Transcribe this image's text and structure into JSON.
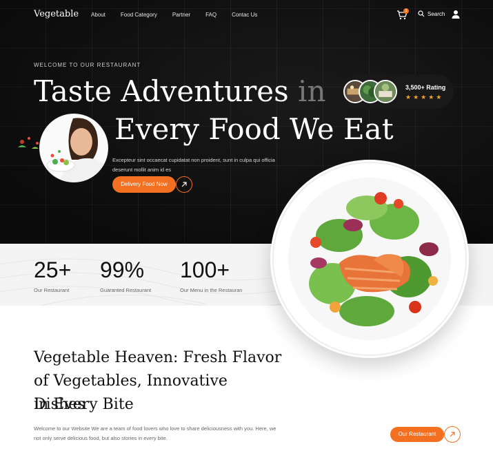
{
  "nav": {
    "logo": "Vegetable",
    "items": [
      "About",
      "Food Category",
      "Partner",
      "FAQ",
      "Contac Us"
    ],
    "cart_count": "3",
    "search_label": "Search"
  },
  "hero": {
    "eyebrow": "WELCOME TO OUR RESTAURANT",
    "title_line1_main": "Taste Adventures ",
    "title_line1_fade": "in",
    "title_line2": "Every Food We Eat",
    "subtitle": "Excepteur sint occaecat cupidatat non proident, sunt in culpa qui officia deserunt mollit anim id es",
    "cta": "Delivery Food Now",
    "rating": {
      "label": "3,500+ Rating",
      "stars": "★★★★★"
    }
  },
  "stats": [
    {
      "value": "25+",
      "label": "Our Restaurant"
    },
    {
      "value": "99%",
      "label": "Guaranted Restaurant"
    },
    {
      "value": "100+",
      "label": "Our Menu in the Restauran"
    }
  ],
  "about": {
    "heading": [
      "Vegetable Heaven: Fresh Flavor",
      "of Vegetables, Innovative Dishes",
      "in Every Bite"
    ],
    "description": "Welcome to our Website We are a team of food lovers who love to share deliciousness with you. Here, we not only serve delicious food, but also stories in every bite.",
    "cta": "Our Restaurant"
  },
  "colors": {
    "accent": "#f37021",
    "hero_bg": "#0f0f0f",
    "star": "#f5a623"
  }
}
